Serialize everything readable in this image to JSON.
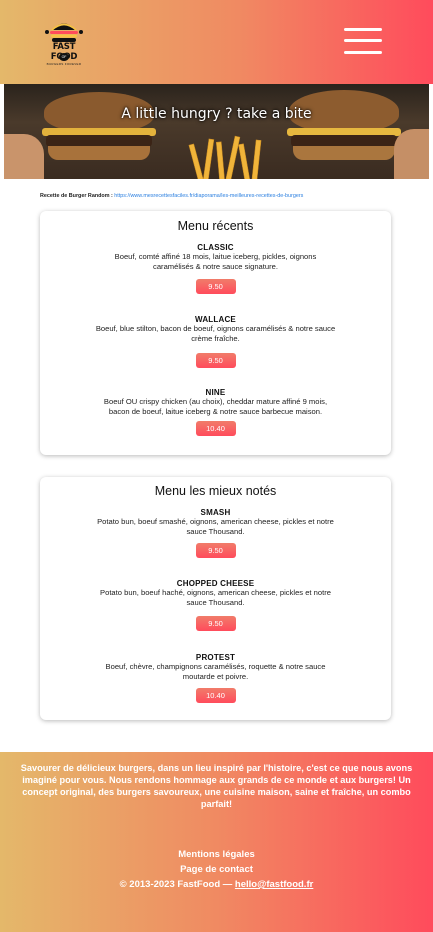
{
  "header": {
    "logo_text": "FAST FOOD",
    "logo_badge": "OF",
    "logo_tagline": "BURGERS FOREVER",
    "menu_icon": "hamburger-menu-icon"
  },
  "hero": {
    "title": "A little hungry ? take a bite"
  },
  "recipe": {
    "label": "Recette de Burger Random :",
    "url": "https://www.mesrecettesfaciles.fr/diaporama/les-meilleures-recettes-de-burgers"
  },
  "recent_menu": {
    "title": "Menu récents",
    "items": [
      {
        "name": "CLASSIC",
        "desc": "Boeuf, comté affiné 18 mois, laitue iceberg, pickles, oignons caramélisés & notre sauce signature.",
        "price": "9.50"
      },
      {
        "name": "WALLACE",
        "desc": "Boeuf, blue stilton, bacon de boeuf, oignons caramélisés & notre sauce crème fraîche.",
        "price": "9.50"
      },
      {
        "name": "NINE",
        "desc": "Boeuf OU crispy chicken (au choix), cheddar mature affiné 9 mois, bacon de boeuf, laitue iceberg & notre sauce barbecue maison.",
        "price": "10.40"
      }
    ]
  },
  "top_menu": {
    "title": "Menu les mieux notés",
    "items": [
      {
        "name": "SMASH",
        "desc": "Potato bun, boeuf smashé, oignons, american cheese, pickles et notre sauce Thousand.",
        "price": "9.50"
      },
      {
        "name": "CHOPPED CHEESE",
        "desc": "Potato bun, boeuf haché, oignons, american cheese, pickles et notre sauce Thousand.",
        "price": "9.50"
      },
      {
        "name": "PROTEST",
        "desc": "Boeuf, chèvre, champignons caramélisés, roquette & notre sauce moutarde et poivre.",
        "price": "10.40"
      }
    ]
  },
  "footer": {
    "description": "Savourer de délicieux burgers, dans un lieu inspiré par l'histoire, c'est ce que nous avons imaginé pour vous. Nous rendons hommage aux grands de ce monde et aux burgers! Un concept original, des burgers savoureux, une cuisine maison, saine et fraîche, un combo parfait!",
    "legal": "Mentions légales",
    "contact": "Page de contact",
    "copyright": "© 2013-2023 FastFood — ",
    "email": "hello@fastfood.fr"
  }
}
